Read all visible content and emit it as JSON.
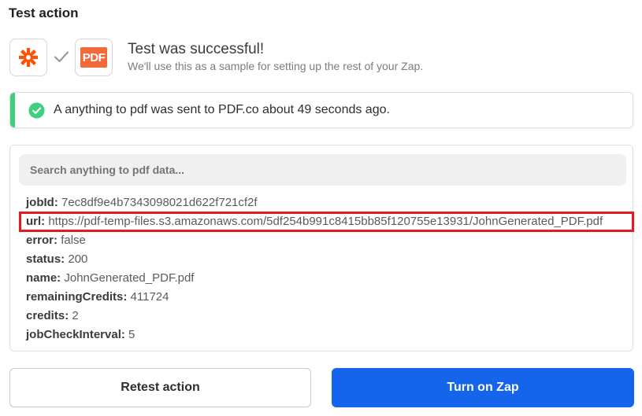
{
  "section_title": "Test action",
  "apps": {
    "trigger_icon": "zapier-asterisk-icon",
    "action_icon": "pdfco-logo-icon",
    "action_logo_text": "PDF"
  },
  "result": {
    "title": "Test was successful!",
    "subtitle": "We'll use this as a sample for setting up the rest of your Zap."
  },
  "alert": {
    "message": "A anything to pdf was sent to PDF.co about 49 seconds ago.",
    "color": "#3fcf7f"
  },
  "data_panel": {
    "search_placeholder": "Search anything to pdf data...",
    "fields": [
      {
        "key": "jobId:",
        "value": "7ec8df9e4b7343098021d622f721cf2f"
      },
      {
        "key": "url:",
        "value": "https://pdf-temp-files.s3.amazonaws.com/5df254b991c8415bb85f120755e13931/JohnGenerated_PDF.pdf"
      },
      {
        "key": "error:",
        "value": "false"
      },
      {
        "key": "status:",
        "value": "200"
      },
      {
        "key": "name:",
        "value": "JohnGenerated_PDF.pdf"
      },
      {
        "key": "remainingCredits:",
        "value": "411724"
      },
      {
        "key": "credits:",
        "value": "2"
      },
      {
        "key": "jobCheckInterval:",
        "value": "5"
      }
    ]
  },
  "buttons": {
    "retest_label": "Retest action",
    "turn_on_label": "Turn on Zap",
    "primary_color": "#1464ec"
  },
  "colors": {
    "zapier_orange": "#ff4f00",
    "pdf_orange": "#f26a3c",
    "highlight_red": "#e01b24"
  }
}
